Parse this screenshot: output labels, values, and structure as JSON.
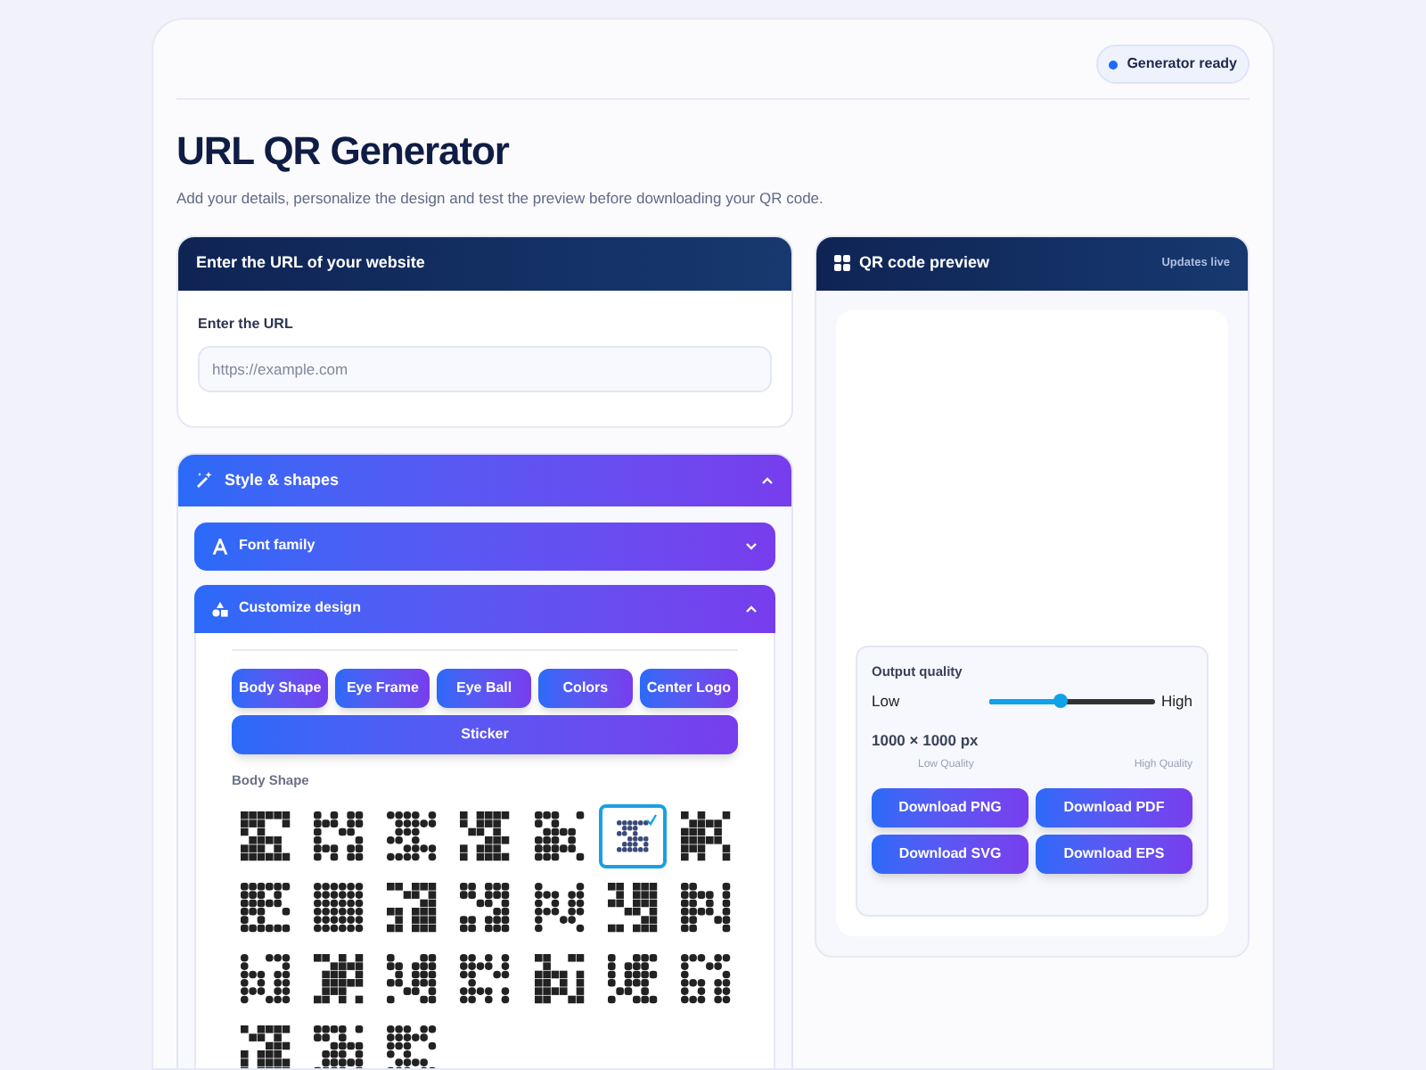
{
  "status_badge": "Generator ready",
  "title": "URL QR Generator",
  "subtitle": "Add your details, personalize the design and test the preview before downloading your QR code.",
  "url_card": {
    "header": "Enter the URL of your website",
    "label": "Enter the URL",
    "placeholder": "https://example.com"
  },
  "style_section": {
    "title": "Style & shapes",
    "expanded": true,
    "subsections": [
      {
        "title": "Font family",
        "expanded": false
      },
      {
        "title": "Customize design",
        "expanded": true
      }
    ],
    "design_tabs": [
      {
        "label": "Body Shape"
      },
      {
        "label": "Eye Frame"
      },
      {
        "label": "Eye Ball"
      },
      {
        "label": "Colors"
      },
      {
        "label": "Center Logo"
      },
      {
        "label": "Sticker"
      }
    ],
    "shapes_label": "Body Shape",
    "shapes": [
      {
        "selected": false
      },
      {
        "selected": false
      },
      {
        "selected": false
      },
      {
        "selected": false
      },
      {
        "selected": false
      },
      {
        "selected": true
      },
      {
        "selected": false
      },
      {
        "selected": false
      },
      {
        "selected": false
      },
      {
        "selected": false
      },
      {
        "selected": false
      },
      {
        "selected": false
      },
      {
        "selected": false
      },
      {
        "selected": false
      },
      {
        "selected": false
      },
      {
        "selected": false
      },
      {
        "selected": false
      },
      {
        "selected": false
      },
      {
        "selected": false
      },
      {
        "selected": false
      },
      {
        "selected": false
      },
      {
        "selected": false
      },
      {
        "selected": false
      },
      {
        "selected": false
      }
    ]
  },
  "preview": {
    "title": "QR code preview",
    "note": "Updates live",
    "quality": {
      "label": "Output quality",
      "low": "Low",
      "high": "High",
      "level": 0.44,
      "size": "1000 × 1000 px",
      "low_caption": "Low Quality",
      "high_caption": "High Quality"
    },
    "downloads": [
      "Download PNG",
      "Download PDF",
      "Download SVG",
      "Download EPS"
    ]
  }
}
